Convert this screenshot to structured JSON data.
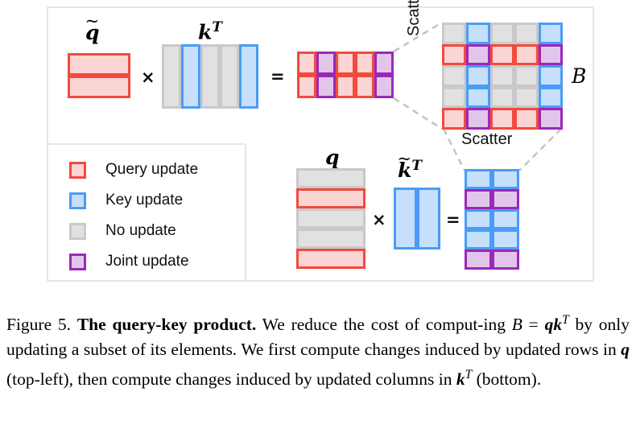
{
  "figure": {
    "label": "Figure 5.",
    "title": "The query-key product.",
    "caption_parts": {
      "p1": " We reduce the cost of comput-ing ",
      "eq_B": "B",
      "eq_equals": " = ",
      "eq_q": "q",
      "eq_k": "k",
      "eq_T": "T",
      "p2": " by only updating a subset of its elements. We first compute changes induced by updated rows in ",
      "var_q": "q",
      "p3": " (top-left), then compute changes induced by updated columns in ",
      "var_k": "k",
      "var_kT": "T",
      "p4": " (bottom)."
    }
  },
  "legend": {
    "items": [
      {
        "label": "Query update",
        "color_border": "#f24a3d",
        "color_fill": "#fbd4d4",
        "swatch": "red-swatch"
      },
      {
        "label": "Key update",
        "color_border": "#4a9cf6",
        "color_fill": "#c6dffb",
        "swatch": "blue-swatch"
      },
      {
        "label": "No update",
        "color_border": "#c9c9c9",
        "color_fill": "#e1e1e1",
        "swatch": "gray-swatch"
      },
      {
        "label": "Joint update",
        "color_border": "#9a28b8",
        "color_fill": "#e2c5ea",
        "swatch": "purple-swatch"
      }
    ]
  },
  "top_row": {
    "operand_a_label": "q",
    "operand_a_tilde": "~",
    "operator_multiply": "×",
    "operand_b_label": "k",
    "operand_b_sup": "T",
    "operator_equals": "=",
    "result_label": ""
  },
  "bottom_row": {
    "operand_a_label": "q",
    "operator_multiply": "×",
    "operand_b_label": "k",
    "operand_b_tilde": "~",
    "operand_b_sup": "T",
    "operator_equals": "="
  },
  "big_matrix": {
    "label": "B",
    "scatter_vertical": "Scatter",
    "scatter_horizontal": "Scatter"
  },
  "chart_data": {
    "type": "heatmap",
    "title": "The query-key product",
    "legend_categories": [
      "Query update",
      "Key update",
      "No update",
      "Joint update"
    ],
    "category_colors": {
      "Query update": "#f24a3d",
      "Key update": "#4a9cf6",
      "No update": "#c9c9c9",
      "Joint update": "#9a28b8"
    },
    "matrices": [
      {
        "name": "q_tilde",
        "label": "q̃",
        "rows": 2,
        "cols": 1,
        "cells": [
          [
            "red"
          ],
          [
            "red"
          ]
        ]
      },
      {
        "name": "k_T",
        "label": "kᵀ",
        "rows": 1,
        "cols": 5,
        "cells": [
          [
            "gray",
            "blue",
            "gray",
            "gray",
            "blue"
          ]
        ]
      },
      {
        "name": "top_result",
        "label": "",
        "rows": 2,
        "cols": 5,
        "cells": [
          [
            "red",
            "purple",
            "red",
            "red",
            "purple"
          ],
          [
            "red",
            "purple",
            "red",
            "red",
            "purple"
          ]
        ]
      },
      {
        "name": "B",
        "label": "B",
        "rows": 5,
        "cols": 5,
        "cells": [
          [
            "gray",
            "blue",
            "gray",
            "gray",
            "blue"
          ],
          [
            "red",
            "purple",
            "red",
            "red",
            "purple"
          ],
          [
            "gray",
            "blue",
            "gray",
            "gray",
            "blue"
          ],
          [
            "gray",
            "blue",
            "gray",
            "gray",
            "blue"
          ],
          [
            "red",
            "purple",
            "red",
            "red",
            "purple"
          ]
        ]
      },
      {
        "name": "q",
        "label": "q",
        "rows": 5,
        "cols": 1,
        "cells": [
          [
            "gray"
          ],
          [
            "red"
          ],
          [
            "gray"
          ],
          [
            "gray"
          ],
          [
            "red"
          ]
        ]
      },
      {
        "name": "k_tilde_T",
        "label": "k̃ᵀ",
        "rows": 1,
        "cols": 2,
        "cells": [
          [
            "blue",
            "blue"
          ]
        ]
      },
      {
        "name": "bottom_result",
        "label": "",
        "rows": 5,
        "cols": 2,
        "cells": [
          [
            "blue",
            "blue"
          ],
          [
            "purple",
            "purple"
          ],
          [
            "blue",
            "blue"
          ],
          [
            "blue",
            "blue"
          ],
          [
            "purple",
            "purple"
          ]
        ]
      }
    ],
    "annotations": [
      "Scatter",
      "Scatter"
    ]
  }
}
